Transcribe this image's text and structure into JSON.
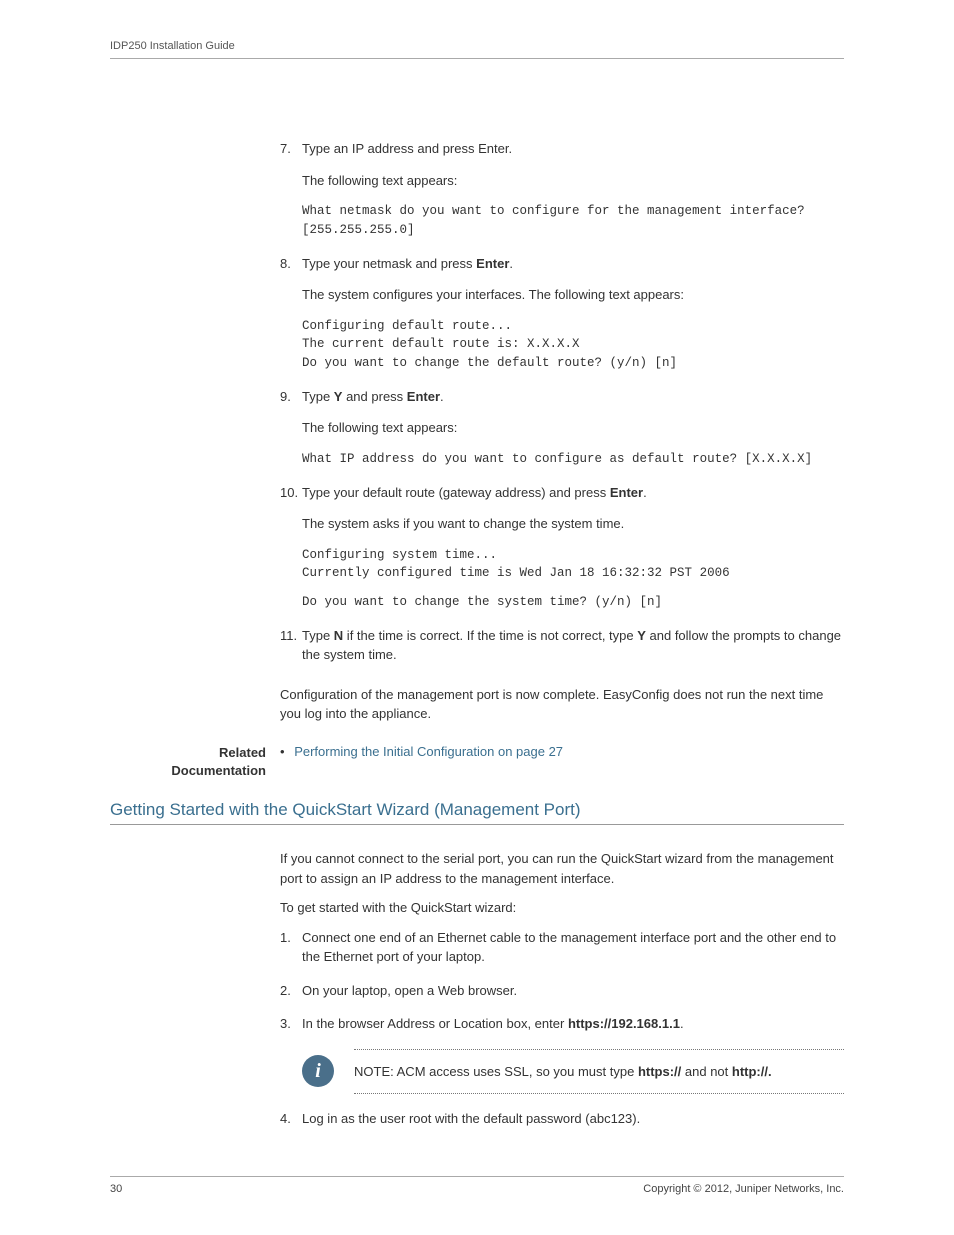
{
  "header": "IDP250 Installation Guide",
  "steps_a": {
    "s7": {
      "num": "7.",
      "text": "Type an IP address and press Enter.",
      "following": "The following text appears:",
      "console": "What netmask do you want to configure for the management interface?\n[255.255.255.0]"
    },
    "s8": {
      "num": "8.",
      "pre": "Type your netmask and press ",
      "bold": "Enter",
      "post": ".",
      "following": "The system configures your interfaces. The following text appears:",
      "console": "Configuring default route...\nThe current default route is: X.X.X.X\nDo you want to change the default route? (y/n) [n]"
    },
    "s9": {
      "num": "9.",
      "pre": "Type ",
      "b1": "Y",
      "mid": " and press ",
      "b2": "Enter",
      "post": ".",
      "following": "The following text appears:",
      "console": "What IP address do you want to configure as default route? [X.X.X.X]"
    },
    "s10": {
      "num": "10.",
      "pre": "Type your default route (gateway address) and press ",
      "bold": "Enter",
      "post": ".",
      "following": "The system asks if you want to change the system time.",
      "console1": "Configuring system time...\nCurrently configured time is Wed Jan 18 16:32:32 PST 2006",
      "console2": "Do you want to change the system time? (y/n) [n]"
    },
    "s11": {
      "num": "11.",
      "pre": "Type ",
      "b1": "N",
      "mid": " if the time is correct. If the time is not correct, type ",
      "b2": "Y",
      "post": " and follow the prompts to change the system time."
    }
  },
  "completion": "Configuration of the management port is now complete. EasyConfig does not run the next time you log into the appliance.",
  "related": {
    "label1": "Related",
    "label2": "Documentation",
    "link": "Performing the Initial Configuration on page 27"
  },
  "section_heading": "Getting Started with the QuickStart Wizard (Management Port)",
  "intro": "If you cannot connect to the serial port, you can run the QuickStart wizard from the management port to assign an IP address to the management interface.",
  "lead": "To get started with the QuickStart wizard:",
  "steps_b": {
    "s1": {
      "num": "1.",
      "text": "Connect one end of an Ethernet cable to the management interface port and the other end to the Ethernet port of your laptop."
    },
    "s2": {
      "num": "2.",
      "text": "On your laptop, open a Web browser."
    },
    "s3": {
      "num": "3.",
      "pre": "In the browser Address or Location box, enter ",
      "bold": "https://192.168.1.1",
      "post": "."
    },
    "s4": {
      "num": "4.",
      "text": "Log in as the user root with the default password (abc123)."
    }
  },
  "note": {
    "label": "NOTE:",
    "pre": "  ACM access uses SSL, so you must type ",
    "b1": "https://",
    "mid": " and not ",
    "b2": "http://."
  },
  "footer": {
    "page": "30",
    "copyright": "Copyright © 2012, Juniper Networks, Inc."
  }
}
